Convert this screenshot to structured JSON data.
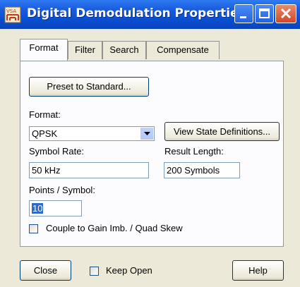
{
  "window": {
    "title": "Digital Demodulation Properties",
    "icon": "vsa-app-icon"
  },
  "tabs": [
    {
      "label": "Format",
      "active": true
    },
    {
      "label": "Filter",
      "active": false
    },
    {
      "label": "Search",
      "active": false
    },
    {
      "label": "Compensate",
      "active": false
    }
  ],
  "format_panel": {
    "preset_button": "Preset to Standard...",
    "format_label": "Format:",
    "format_value": "QPSK",
    "view_states_button": "View State Definitions...",
    "symbol_rate_label": "Symbol Rate:",
    "symbol_rate_value": "50 kHz",
    "result_length_label": "Result Length:",
    "result_length_value": "200 Symbols",
    "points_label": "Points / Symbol:",
    "points_value": "10",
    "couple_label": "Couple to Gain Imb. / Quad Skew",
    "couple_checked": false
  },
  "footer": {
    "close_button": "Close",
    "keep_open_label": "Keep Open",
    "keep_open_checked": false,
    "help_button": "Help"
  }
}
